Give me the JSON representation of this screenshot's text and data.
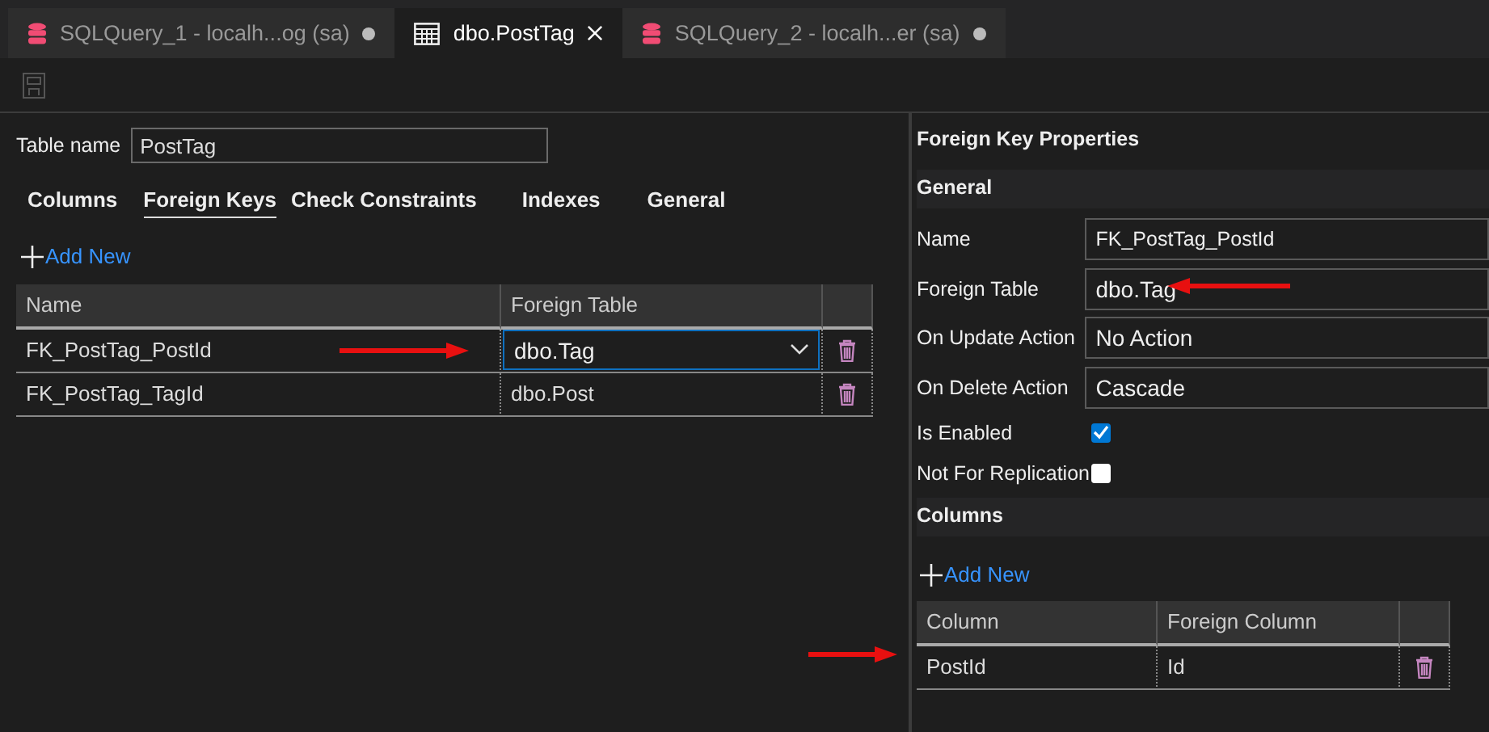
{
  "editor_tabs": [
    {
      "label": "SQLQuery_1 - localh...og (sa)",
      "kind": "query",
      "selected": false,
      "modified": true
    },
    {
      "label": "dbo.PostTag",
      "kind": "table",
      "selected": true,
      "modified": false
    },
    {
      "label": "SQLQuery_2 - localh...er (sa)",
      "kind": "query",
      "selected": false,
      "modified": true
    }
  ],
  "table_name": {
    "label": "Table name",
    "value": "PostTag"
  },
  "designer_tabs": [
    {
      "label": "Columns",
      "selected": false
    },
    {
      "label": "Foreign Keys",
      "selected": true
    },
    {
      "label": "Check Constraints",
      "selected": false
    },
    {
      "label": "Indexes",
      "selected": false
    },
    {
      "label": "General",
      "selected": false
    }
  ],
  "foreign_keys": {
    "add_new": "Add New",
    "columns": [
      "Name",
      "Foreign Table"
    ],
    "rows": [
      {
        "name": "FK_PostTag_PostId",
        "foreign_table": "dbo.Tag",
        "editing": true
      },
      {
        "name": "FK_PostTag_TagId",
        "foreign_table": "dbo.Post",
        "editing": false
      }
    ]
  },
  "properties": {
    "title": "Foreign Key Properties",
    "general": {
      "heading": "General",
      "rows": [
        {
          "label": "Name",
          "kind": "text",
          "value": "FK_PostTag_PostId"
        },
        {
          "label": "Foreign Table",
          "kind": "text",
          "value": "dbo.Tag"
        },
        {
          "label": "On Update Action",
          "kind": "text",
          "value": "No Action"
        },
        {
          "label": "On Delete Action",
          "kind": "text",
          "value": "Cascade"
        },
        {
          "label": "Is Enabled",
          "kind": "checkbox",
          "checked": true
        },
        {
          "label": "Not For Replication",
          "kind": "checkbox",
          "checked": false
        }
      ]
    },
    "columns": {
      "heading": "Columns",
      "add_new": "Add New",
      "columns": [
        "Column",
        "Foreign Column"
      ],
      "rows": [
        {
          "column": "PostId",
          "foreign_column": "Id"
        }
      ]
    }
  }
}
